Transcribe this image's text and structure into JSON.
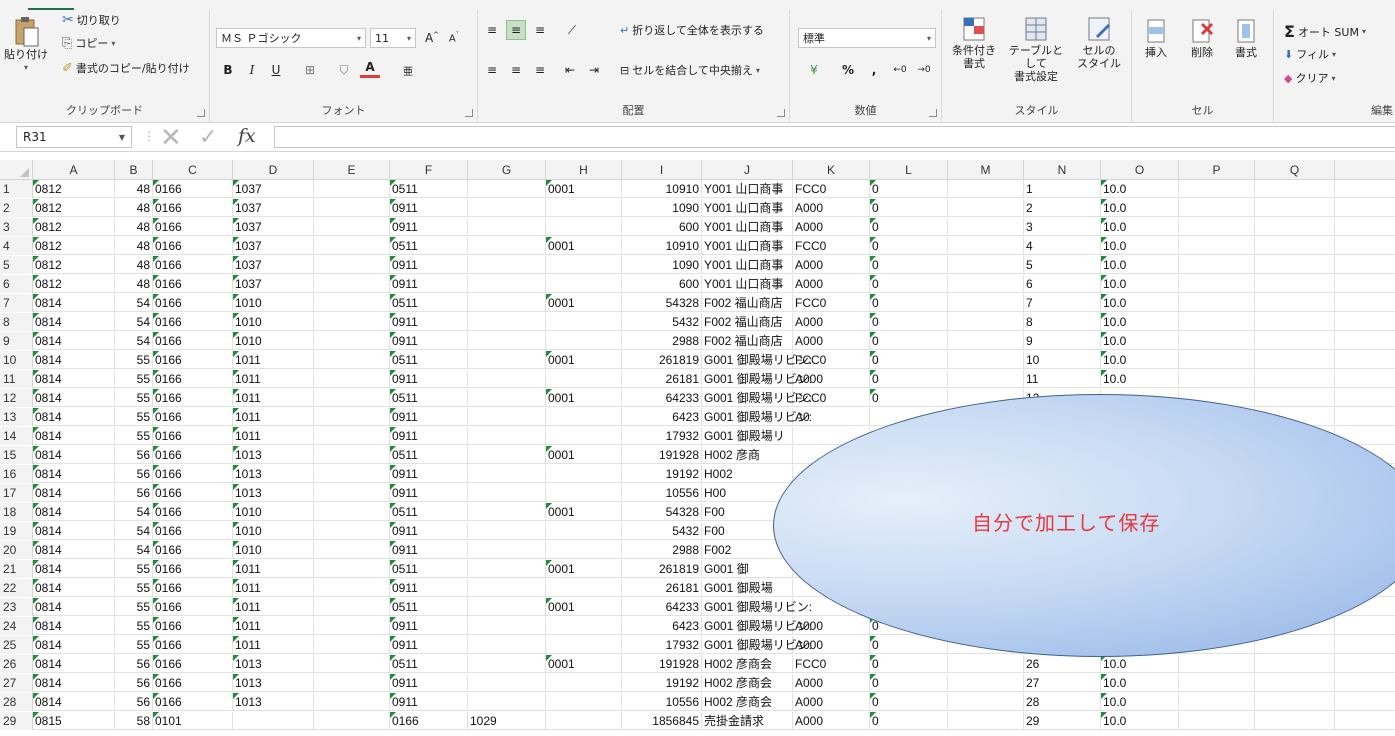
{
  "ribbon": {
    "clipboard": {
      "paste": "貼り付け",
      "cut": "切り取り",
      "copy": "コピー",
      "format_painter": "書式のコピー/貼り付け",
      "label": "クリップボード"
    },
    "font": {
      "name": "ＭＳ Ｐゴシック",
      "size": "11",
      "label": "フォント",
      "bold": "B",
      "italic": "I",
      "underline": "U"
    },
    "alignment": {
      "wrap": "折り返して全体を表示する",
      "merge": "セルを結合して中央揃え",
      "label": "配置"
    },
    "number": {
      "format": "標準",
      "percent": "%",
      "comma": ",",
      "label": "数値"
    },
    "styles": {
      "conditional_1": "条件付き",
      "conditional_2": "書式",
      "table_1": "テーブルとして",
      "table_2": "書式設定",
      "cell_1": "セルの",
      "cell_2": "スタイル",
      "label": "スタイル"
    },
    "cells": {
      "insert": "挿入",
      "delete": "削除",
      "format": "書式",
      "label": "セル"
    },
    "editing": {
      "autosum": "オート SUM",
      "fill": "フィル",
      "clear": "クリア",
      "label": "編集"
    }
  },
  "formula_bar": {
    "name_box": "R31",
    "fx": "fx",
    "formula": ""
  },
  "columns": [
    "A",
    "B",
    "C",
    "D",
    "E",
    "F",
    "G",
    "H",
    "I",
    "J",
    "K",
    "L",
    "M",
    "N",
    "O",
    "P",
    "Q"
  ],
  "rows": [
    {
      "n": "1",
      "a": "0812",
      "b": "48",
      "c": "0166",
      "d": "1037",
      "f": "0511",
      "g": "",
      "h": "0001",
      "i": "10910",
      "j": "Y001 山口商事",
      "k": "FCC0",
      "l": "0",
      "o": "10.0"
    },
    {
      "n": "2",
      "a": "0812",
      "b": "48",
      "c": "0166",
      "d": "1037",
      "f": "0911",
      "g": "",
      "h": "",
      "i": "1090",
      "j": "Y001 山口商事",
      "k": "A000",
      "l": "0",
      "o": "10.0"
    },
    {
      "n": "3",
      "a": "0812",
      "b": "48",
      "c": "0166",
      "d": "1037",
      "f": "0911",
      "g": "",
      "h": "",
      "i": "600",
      "j": "Y001 山口商事",
      "k": "A000",
      "l": "0",
      "o": "10.0"
    },
    {
      "n": "4",
      "a": "0812",
      "b": "48",
      "c": "0166",
      "d": "1037",
      "f": "0511",
      "g": "",
      "h": "0001",
      "i": "10910",
      "j": "Y001 山口商事",
      "k": "FCC0",
      "l": "0",
      "o": "10.0"
    },
    {
      "n": "5",
      "a": "0812",
      "b": "48",
      "c": "0166",
      "d": "1037",
      "f": "0911",
      "g": "",
      "h": "",
      "i": "1090",
      "j": "Y001 山口商事",
      "k": "A000",
      "l": "0",
      "o": "10.0"
    },
    {
      "n": "6",
      "a": "0812",
      "b": "48",
      "c": "0166",
      "d": "1037",
      "f": "0911",
      "g": "",
      "h": "",
      "i": "600",
      "j": "Y001 山口商事",
      "k": "A000",
      "l": "0",
      "o": "10.0"
    },
    {
      "n": "7",
      "a": "0814",
      "b": "54",
      "c": "0166",
      "d": "1010",
      "f": "0511",
      "g": "",
      "h": "0001",
      "i": "54328",
      "j": "F002 福山商店",
      "k": "FCC0",
      "l": "0",
      "o": "10.0"
    },
    {
      "n": "8",
      "a": "0814",
      "b": "54",
      "c": "0166",
      "d": "1010",
      "f": "0911",
      "g": "",
      "h": "",
      "i": "5432",
      "j": "F002 福山商店",
      "k": "A000",
      "l": "0",
      "o": "10.0"
    },
    {
      "n": "9",
      "a": "0814",
      "b": "54",
      "c": "0166",
      "d": "1010",
      "f": "0911",
      "g": "",
      "h": "",
      "i": "2988",
      "j": "F002 福山商店",
      "k": "A000",
      "l": "0",
      "o": "10.0"
    },
    {
      "n": "10",
      "a": "0814",
      "b": "55",
      "c": "0166",
      "d": "1011",
      "f": "0511",
      "g": "",
      "h": "0001",
      "i": "261819",
      "j": "G001 御殿場リビン:",
      "k": "FCC0",
      "l": "0",
      "o": "10.0"
    },
    {
      "n": "11",
      "a": "0814",
      "b": "55",
      "c": "0166",
      "d": "1011",
      "f": "0911",
      "g": "",
      "h": "",
      "i": "26181",
      "j": "G001 御殿場リビン:",
      "k": "A000",
      "l": "0",
      "o": "10.0"
    },
    {
      "n": "12",
      "a": "0814",
      "b": "55",
      "c": "0166",
      "d": "1011",
      "f": "0511",
      "g": "",
      "h": "0001",
      "i": "64233",
      "j": "G001 御殿場リビン:",
      "k": "FCC0",
      "l": "0",
      "o": ""
    },
    {
      "n": "13",
      "a": "0814",
      "b": "55",
      "c": "0166",
      "d": "1011",
      "f": "0911",
      "g": "",
      "h": "",
      "i": "6423",
      "j": "G001 御殿場リビン:",
      "k": "A0",
      "l": "",
      "o": ""
    },
    {
      "n": "14",
      "a": "0814",
      "b": "55",
      "c": "0166",
      "d": "1011",
      "f": "0911",
      "g": "",
      "h": "",
      "i": "17932",
      "j": "G001 御殿場リ",
      "k": "",
      "l": "",
      "o": ""
    },
    {
      "n": "15",
      "a": "0814",
      "b": "56",
      "c": "0166",
      "d": "1013",
      "f": "0511",
      "g": "",
      "h": "0001",
      "i": "191928",
      "j": "H002 彦商",
      "k": "",
      "l": "",
      "o": ""
    },
    {
      "n": "16",
      "a": "0814",
      "b": "56",
      "c": "0166",
      "d": "1013",
      "f": "0911",
      "g": "",
      "h": "",
      "i": "19192",
      "j": "H002",
      "k": "",
      "l": "",
      "o": ""
    },
    {
      "n": "17",
      "a": "0814",
      "b": "56",
      "c": "0166",
      "d": "1013",
      "f": "0911",
      "g": "",
      "h": "",
      "i": "10556",
      "j": "H00",
      "k": "",
      "l": "",
      "o": ""
    },
    {
      "n": "18",
      "a": "0814",
      "b": "54",
      "c": "0166",
      "d": "1010",
      "f": "0511",
      "g": "",
      "h": "0001",
      "i": "54328",
      "j": "F00",
      "k": "",
      "l": "",
      "o": ""
    },
    {
      "n": "19",
      "a": "0814",
      "b": "54",
      "c": "0166",
      "d": "1010",
      "f": "0911",
      "g": "",
      "h": "",
      "i": "5432",
      "j": "F00",
      "k": "",
      "l": "",
      "o": ""
    },
    {
      "n": "20",
      "a": "0814",
      "b": "54",
      "c": "0166",
      "d": "1010",
      "f": "0911",
      "g": "",
      "h": "",
      "i": "2988",
      "j": "F002",
      "k": "",
      "l": "",
      "o": ""
    },
    {
      "n": "21",
      "a": "0814",
      "b": "55",
      "c": "0166",
      "d": "1011",
      "f": "0511",
      "g": "",
      "h": "0001",
      "i": "261819",
      "j": "G001 御",
      "k": "",
      "l": "",
      "o": ""
    },
    {
      "n": "22",
      "a": "0814",
      "b": "55",
      "c": "0166",
      "d": "1011",
      "f": "0911",
      "g": "",
      "h": "",
      "i": "26181",
      "j": "G001 御殿場",
      "k": "",
      "l": "",
      "o": ""
    },
    {
      "n": "23",
      "a": "0814",
      "b": "55",
      "c": "0166",
      "d": "1011",
      "f": "0511",
      "g": "",
      "h": "0001",
      "i": "64233",
      "j": "G001 御殿場リビン:",
      "k": "",
      "l": "",
      "o": ""
    },
    {
      "n": "24",
      "a": "0814",
      "b": "55",
      "c": "0166",
      "d": "1011",
      "f": "0911",
      "g": "",
      "h": "",
      "i": "6423",
      "j": "G001 御殿場リビン:",
      "k": "A000",
      "l": "0",
      "o": ""
    },
    {
      "n": "25",
      "a": "0814",
      "b": "55",
      "c": "0166",
      "d": "1011",
      "f": "0911",
      "g": "",
      "h": "",
      "i": "17932",
      "j": "G001 御殿場リビン:",
      "k": "A000",
      "l": "0",
      "o": "10.0"
    },
    {
      "n": "26",
      "a": "0814",
      "b": "56",
      "c": "0166",
      "d": "1013",
      "f": "0511",
      "g": "",
      "h": "0001",
      "i": "191928",
      "j": "H002 彦商会",
      "k": "FCC0",
      "l": "0",
      "o": "10.0"
    },
    {
      "n": "27",
      "a": "0814",
      "b": "56",
      "c": "0166",
      "d": "1013",
      "f": "0911",
      "g": "",
      "h": "",
      "i": "19192",
      "j": "H002 彦商会",
      "k": "A000",
      "l": "0",
      "o": "10.0"
    },
    {
      "n": "28",
      "a": "0814",
      "b": "56",
      "c": "0166",
      "d": "1013",
      "f": "0911",
      "g": "",
      "h": "",
      "i": "10556",
      "j": "H002 彦商会",
      "k": "A000",
      "l": "0",
      "o": "10.0"
    },
    {
      "n": "29",
      "a": "0815",
      "b": "58",
      "c": "0101",
      "d": "",
      "f": "0166",
      "g": "1029",
      "h": "",
      "i": "1856845",
      "j": "売掛金請求",
      "k": "A000",
      "l": "0",
      "o": "10.0"
    }
  ],
  "callout": {
    "text": "自分で加工して保存"
  }
}
